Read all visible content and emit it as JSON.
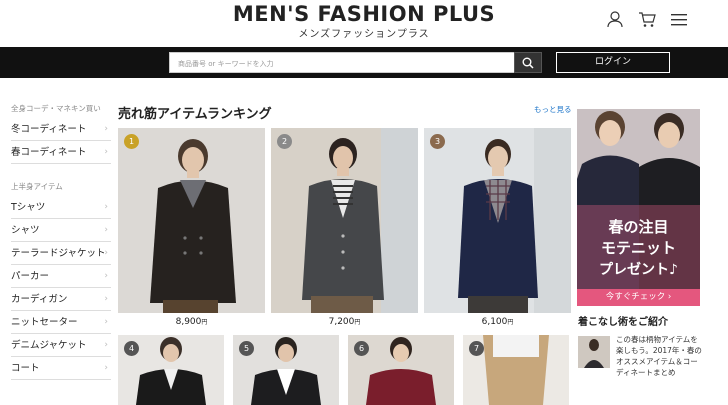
{
  "header": {
    "title": "MEN'S FASHION PLUS",
    "subtitle": "メンズファッションプラス"
  },
  "search": {
    "placeholder": "商品番号 or キーワードを入力"
  },
  "login_label": "ログイン",
  "sidebar": {
    "section1_heading": "全身コーデ・マネキン買い",
    "section1_items": [
      "冬コーディネート",
      "春コーディネート"
    ],
    "section2_heading": "上半身アイテム",
    "section2_items": [
      "Tシャツ",
      "シャツ",
      "テーラードジャケット",
      "パーカー",
      "カーディガン",
      "ニットセーター",
      "デニムジャケット",
      "コート"
    ]
  },
  "ranking": {
    "title": "売れ筋アイテムランキング",
    "more_link": "もっと見る",
    "items": [
      {
        "rank": "1",
        "price": "8,900",
        "unit": "円",
        "rank_color": "#c9a227"
      },
      {
        "rank": "2",
        "price": "7,200",
        "unit": "円",
        "rank_color": "#8a8a8a"
      },
      {
        "rank": "3",
        "price": "6,100",
        "unit": "円",
        "rank_color": "#8b6a4e"
      }
    ],
    "row2_ranks": [
      "4",
      "5",
      "6",
      "7"
    ]
  },
  "banner": {
    "line1": "春の注目",
    "line2": "モテニット",
    "line3": "プレゼント♪",
    "cta": "今すぐチェック ›"
  },
  "coordinate": {
    "title": "着こなし術をご紹介",
    "article_text": "この春は柄物アイテムを楽しもう。2017年・春のオススメアイテム＆コーディネートまとめ"
  },
  "icons": [
    "user-icon",
    "cart-icon",
    "menu-icon",
    "search-icon",
    "chevron-right-icon"
  ]
}
